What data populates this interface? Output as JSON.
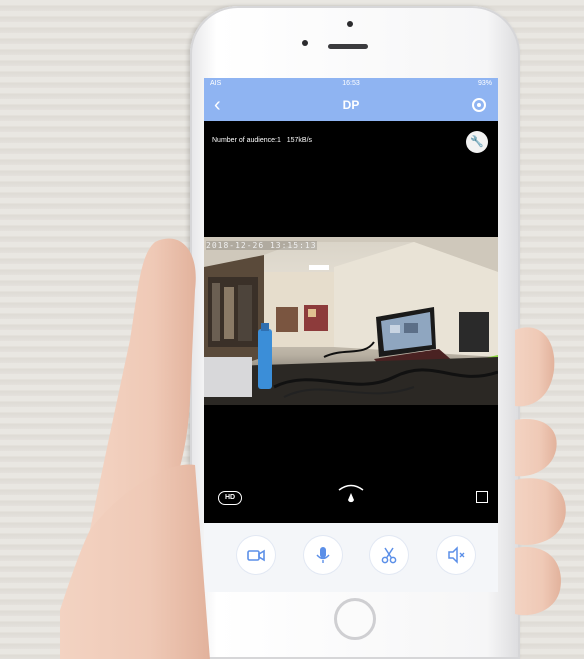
{
  "statusbar": {
    "carrier": "AIS",
    "time": "16:53",
    "battery": "93%"
  },
  "navbar": {
    "title": "DP"
  },
  "video": {
    "audience_label": "Number of audience:1",
    "bitrate": "157kB/s",
    "timestamp": "2018-12-26 13:15:13"
  },
  "controls": {
    "quality_label": "HD"
  },
  "toolbar": {
    "buttons": [
      {
        "icon": "record-video-icon"
      },
      {
        "icon": "microphone-icon"
      },
      {
        "icon": "scissors-icon"
      },
      {
        "icon": "speaker-icon"
      }
    ]
  },
  "colors": {
    "accent": "#8fb4f2",
    "icon_blue": "#5b8fe8"
  }
}
